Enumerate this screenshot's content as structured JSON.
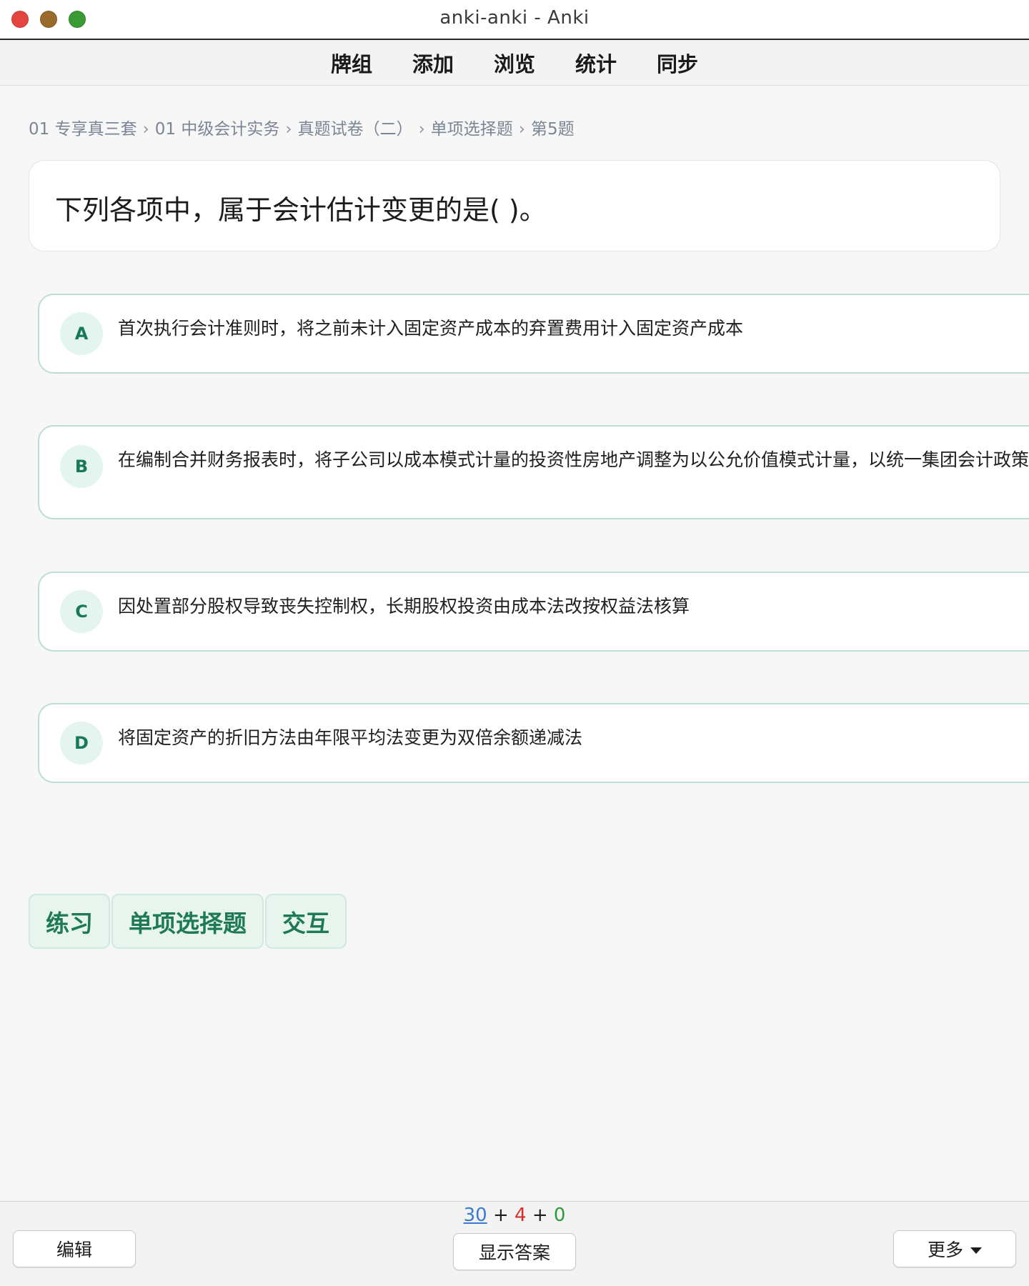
{
  "window": {
    "title": "anki-anki - Anki"
  },
  "nav": {
    "items": [
      "牌组",
      "添加",
      "浏览",
      "统计",
      "同步"
    ]
  },
  "breadcrumb": {
    "items": [
      "01 专享真三套",
      "01 中级会计实务",
      "真题试卷（二）",
      "单项选择题",
      "第5题"
    ],
    "separator": "›"
  },
  "question": {
    "text": "下列各项中，属于会计估计变更的是( )。"
  },
  "options": [
    {
      "letter": "A",
      "text": "首次执行会计准则时，将之前未计入固定资产成本的弃置费用计入固定资产成本"
    },
    {
      "letter": "B",
      "text": "在编制合并财务报表时，将子公司以成本模式计量的投资性房地产调整为以公允价值模式计量，以统一集团会计政策"
    },
    {
      "letter": "C",
      "text": "因处置部分股权导致丧失控制权，长期股权投资由成本法改按权益法核算"
    },
    {
      "letter": "D",
      "text": "将固定资产的折旧方法由年限平均法变更为双倍余额递减法"
    }
  ],
  "tags": [
    "练习",
    "单项选择题",
    "交互"
  ],
  "bottom": {
    "edit_label": "编辑",
    "show_answer_label": "显示答案",
    "more_label": "更多",
    "counts": {
      "new": "30",
      "learn": "4",
      "review": "0",
      "plus": "+"
    }
  },
  "colors": {
    "accent_green": "#177a57",
    "option_border": "#b9dfd0",
    "new_count": "#3a7bd5",
    "learn_count": "#d62f2f",
    "review_count": "#2a9b3a"
  }
}
